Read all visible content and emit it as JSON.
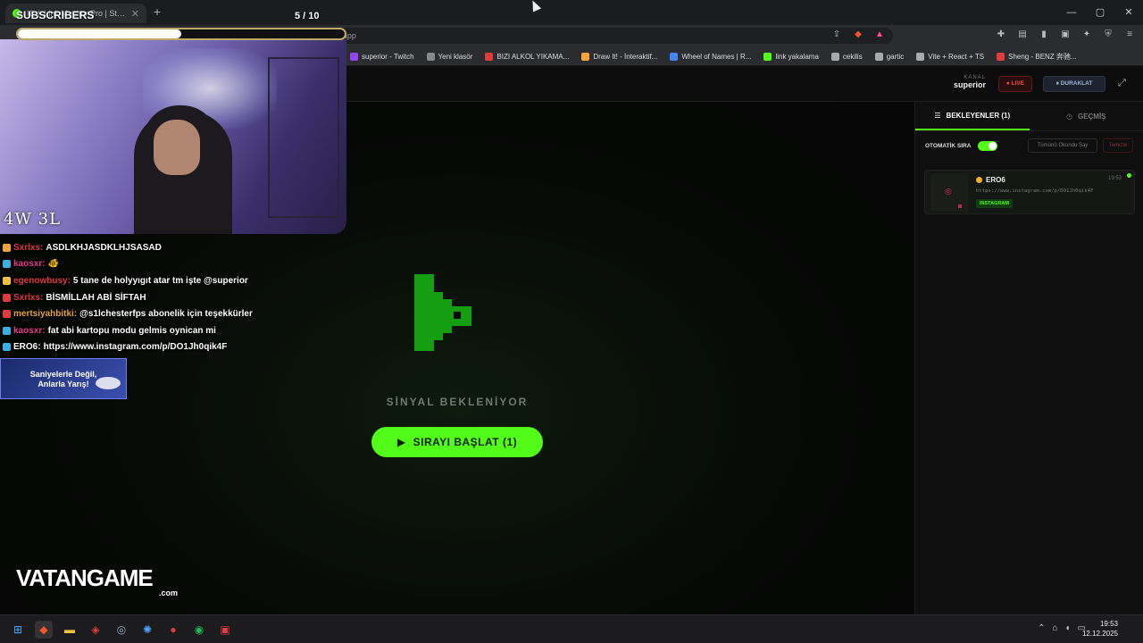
{
  "browser": {
    "tab_title": "Kick Link Monitor Pro | Stream D...",
    "tab_close": "✕",
    "new_tab": "+",
    "url": "linkyakalama.netlify.app",
    "window_controls": [
      "—",
      "▢",
      "✕"
    ]
  },
  "bookmarks": [
    {
      "label": "superior - Twitch",
      "color": "#9146ff"
    },
    {
      "label": "Yeni klasör",
      "color": "#888888"
    },
    {
      "label": "BIZI ALKOL YIKAMA...",
      "color": "#e23b3b"
    },
    {
      "label": "Draw It! - İnteraktif...",
      "color": "#f2a33a"
    },
    {
      "label": "Wheel of Names | R...",
      "color": "#4285f4"
    },
    {
      "label": "link yakalama",
      "color": "#53fc18"
    },
    {
      "label": "cekilis",
      "color": "#aaaaaa"
    },
    {
      "label": "gartic",
      "color": "#aaaaaa"
    },
    {
      "label": "Vite + React + TS",
      "color": "#aaaaaa"
    },
    {
      "label": "Sheng - BENZ 奔驰...",
      "color": "#e23b3b"
    }
  ],
  "header": {
    "channel_label": "KANAL",
    "channel_value": "superior",
    "live_label": "● LIVE",
    "pause_label": "⏸  DURAKLAT"
  },
  "stage": {
    "status_text": "SİNYAL BEKLENİYOR",
    "start_button": "SIRAYI BAŞLAT (1)",
    "play_icon": "▶"
  },
  "panel": {
    "tab_waiting": "BEKLEYENLER (1)",
    "tab_history": "GEÇMİŞ",
    "auto_queue_label": "OTOMATİK SIRA",
    "mark_all": "Tümünü Okundu Say",
    "clear": "Temizle",
    "card": {
      "user": "ERO6",
      "time": "19:53",
      "url": "https://www.instagram.com/p/DO1Jh0qik4F",
      "platform": "INSTAGRAM"
    }
  },
  "overlay": {
    "subs_title": "SUBSCRIBERS",
    "subs_count": "5  / 10",
    "subs_progress": 0.5,
    "record": "4W  3L",
    "ad_line1": "Saniyelerle Değil,",
    "ad_line2": "Anlarla Yarış!",
    "sponsor": "VATANGAME",
    "sponsor_suffix": ".com",
    "chat": [
      {
        "user": "Sxrlxs:",
        "color": "#e33b3b",
        "msg": "ASDLKHJASDKLHJSASAD"
      },
      {
        "user": "kaosxr:",
        "color": "#e33b8a",
        "msg": "🐠"
      },
      {
        "user": "egenowbusy:",
        "color": "#e33b3b",
        "msg": "5 tane de holyyıgıt atar tm işte @superior"
      },
      {
        "user": "Sxrlxs:",
        "color": "#e33b3b",
        "msg": "BİSMİLLAH ABİ SİFTAH"
      },
      {
        "user": "mertsiyahbitki:",
        "color": "#e3a23b",
        "msg": "@s1lchesterfps abonelik için teşekkürler"
      },
      {
        "user": "kaosxr:",
        "color": "#e33b8a",
        "msg": "fat abi kartopu modu gelmis oynican mi"
      },
      {
        "user": "ERO6:",
        "color": "#ffffff",
        "msg": "https://www.instagram.com/p/DO1Jh0qik4F"
      }
    ]
  },
  "taskbar": {
    "time": "19:53",
    "date": "12.12.2025"
  }
}
